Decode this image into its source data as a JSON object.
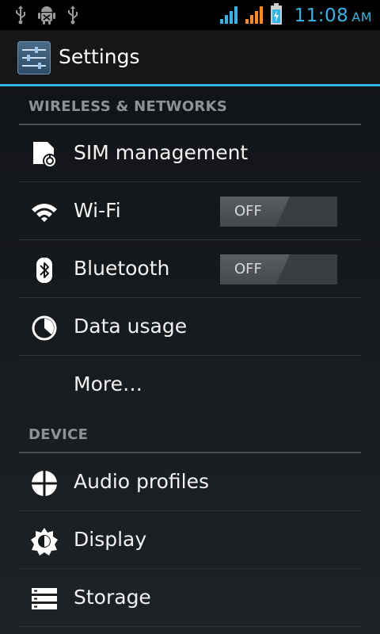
{
  "status_bar": {
    "time": "11:08",
    "ampm": "AM",
    "icons": [
      "usb-icon",
      "android-debug-icon",
      "usb-icon",
      "signal-blue-icon",
      "signal-orange-icon",
      "battery-charging-icon"
    ],
    "accent_color": "#33b5e5"
  },
  "action_bar": {
    "title": "Settings",
    "icon": "settings-sliders-icon"
  },
  "sections": {
    "wireless": {
      "label": "WIRELESS & NETWORKS"
    },
    "device": {
      "label": "DEVICE"
    }
  },
  "items": {
    "sim": {
      "label": "SIM management",
      "icon": "sim-card-icon"
    },
    "wifi": {
      "label": "Wi-Fi",
      "icon": "wifi-icon",
      "toggle": "OFF"
    },
    "bluetooth": {
      "label": "Bluetooth",
      "icon": "bluetooth-icon",
      "toggle": "OFF"
    },
    "data": {
      "label": "Data usage",
      "icon": "data-usage-icon"
    },
    "more": {
      "label": "More…"
    },
    "audio": {
      "label": "Audio profiles",
      "icon": "audio-profiles-icon"
    },
    "display": {
      "label": "Display",
      "icon": "display-brightness-icon"
    },
    "storage": {
      "label": "Storage",
      "icon": "storage-icon"
    }
  }
}
